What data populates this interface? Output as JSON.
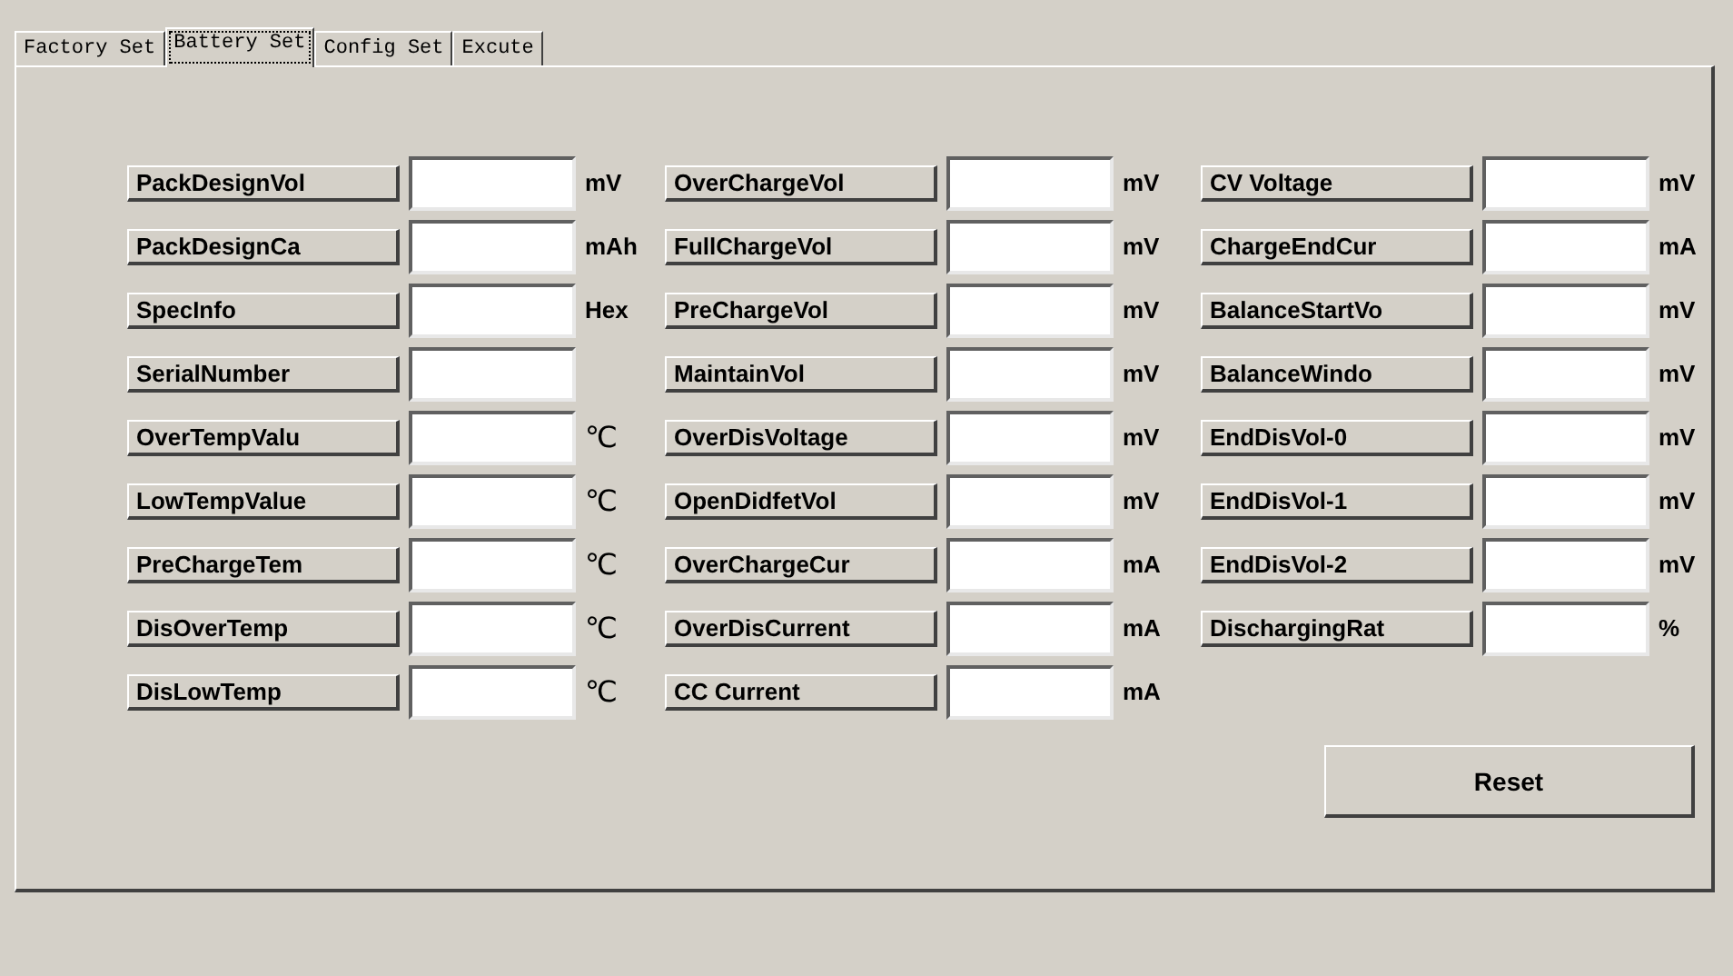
{
  "tabs": [
    {
      "label": "Factory Set",
      "selected": false
    },
    {
      "label": "Battery Set",
      "selected": true
    },
    {
      "label": "Config Set",
      "selected": false
    },
    {
      "label": "Excute",
      "selected": false
    }
  ],
  "columns": [
    [
      {
        "label": "PackDesignVol",
        "unit": "mV"
      },
      {
        "label": "PackDesignCa",
        "unit": "mAh"
      },
      {
        "label": "SpecInfo",
        "unit": "Hex"
      },
      {
        "label": "SerialNumber"
      },
      {
        "label": "OverTempValu",
        "unit": "℃"
      },
      {
        "label": "LowTempValue",
        "unit": "℃"
      },
      {
        "label": "PreChargeTem",
        "unit": "℃"
      },
      {
        "label": "DisOverTemp",
        "unit": "℃"
      },
      {
        "label": "DisLowTemp",
        "unit": "℃"
      }
    ],
    [
      {
        "label": "OverChargeVol",
        "unit": "mV"
      },
      {
        "label": "FullChargeVol",
        "unit": "mV"
      },
      {
        "label": "PreChargeVol",
        "unit": "mV"
      },
      {
        "label": "MaintainVol",
        "unit": "mV"
      },
      {
        "label": "OverDisVoltage",
        "unit": "mV"
      },
      {
        "label": "OpenDidfetVol",
        "unit": "mV"
      },
      {
        "label": "OverChargeCur",
        "unit": "mA"
      },
      {
        "label": "OverDisCurrent",
        "unit": "mA"
      },
      {
        "label": "CC Current",
        "unit": "mA"
      }
    ],
    [
      {
        "label": "CV Voltage",
        "unit": "mV"
      },
      {
        "label": "ChargeEndCur",
        "unit": "mA"
      },
      {
        "label": "BalanceStartVo",
        "unit": "mV"
      },
      {
        "label": "BalanceWindo",
        "unit": "mV"
      },
      {
        "label": "EndDisVol-0",
        "unit": "mV"
      },
      {
        "label": "EndDisVol-1",
        "unit": "mV"
      },
      {
        "label": "EndDisVol-2",
        "unit": "mV"
      },
      {
        "label": "DischargingRat",
        "unit": "%"
      }
    ]
  ],
  "reset_button": "Reset"
}
